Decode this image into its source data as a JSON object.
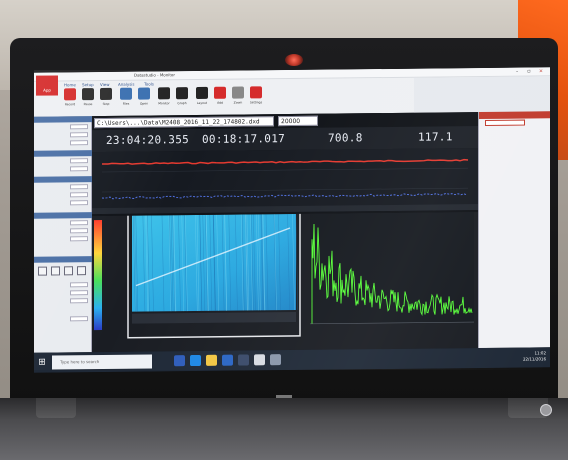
{
  "scene": {
    "description_color_accent": "#ff6a1f"
  },
  "app": {
    "window_title": "Datastudio - Monitor",
    "ribbon_tabs": [
      "Home",
      "Setup",
      "View",
      "Analysis",
      "Tools"
    ],
    "app_button_label": "App",
    "tools": [
      {
        "label": "Record",
        "icon": "record-icon",
        "color": "#d52b2b"
      },
      {
        "label": "Pause",
        "icon": "pause-icon",
        "color": "#2b2b2b"
      },
      {
        "label": "Stop",
        "icon": "stop-icon",
        "color": "#2b2b2b"
      },
      {
        "label": "Files",
        "icon": "files-icon",
        "color": "#3a6fb0"
      },
      {
        "label": "Open",
        "icon": "open-icon",
        "color": "#3a6fb0"
      },
      {
        "label": "Monitor",
        "icon": "monitor-icon",
        "color": "#222"
      },
      {
        "label": "Graph",
        "icon": "graph-icon",
        "color": "#222"
      },
      {
        "label": "Layout",
        "icon": "layout-icon",
        "color": "#222"
      },
      {
        "label": "Add",
        "icon": "add-icon",
        "color": "#d52b2b"
      },
      {
        "label": "Zoom",
        "icon": "zoom-icon",
        "color": "#888"
      },
      {
        "label": "Settings",
        "icon": "gear-icon",
        "color": "#d52b2b"
      }
    ]
  },
  "main": {
    "file_path": "C:\\Users\\...\\Data\\M2408_2016_11_22_174802.dxd",
    "rate": "20000",
    "readouts": {
      "clock": "23:04:20.355",
      "elapsed": "00:18:17.017",
      "value_1": "700.8",
      "value_2": "117.1"
    }
  },
  "taskbar": {
    "search_placeholder": "Type here to search",
    "clock_time": "11:02",
    "clock_date": "22/11/2016"
  },
  "colors": {
    "red_trace": "#e5392f",
    "blue_trace": "#4f6fe0",
    "spectrum": "#58ff3a",
    "waterfall": "#36b6e0"
  }
}
